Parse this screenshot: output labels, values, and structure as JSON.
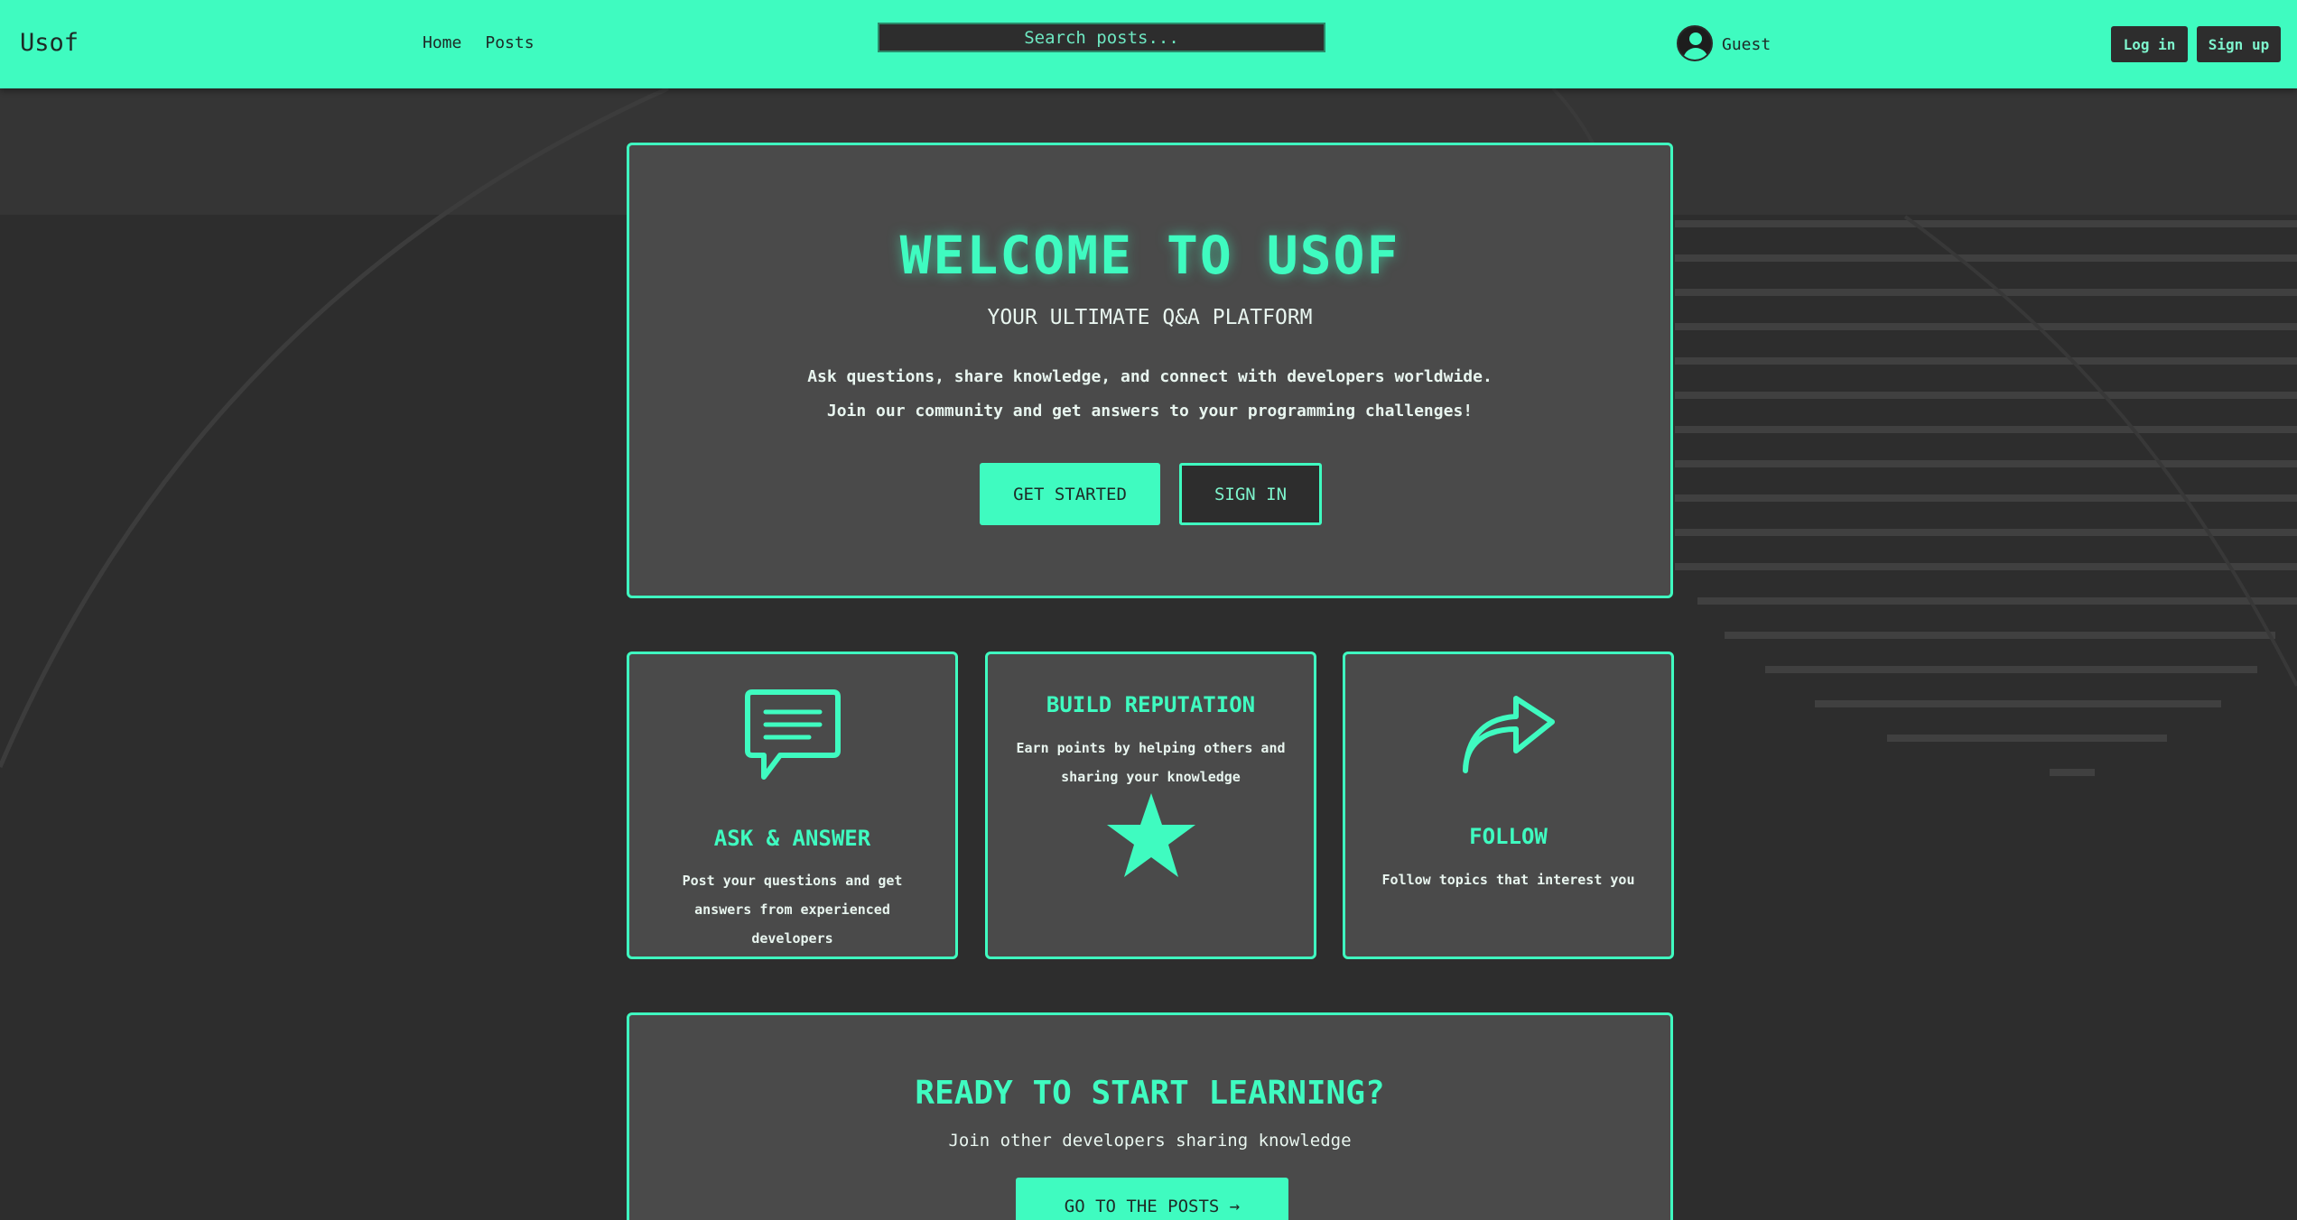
{
  "header": {
    "logo": "Usof",
    "nav": [
      "Home",
      "Posts"
    ],
    "search_placeholder": "Search posts...",
    "user_name": "Guest",
    "login_label": "Log in",
    "signup_label": "Sign up"
  },
  "hero": {
    "title": "WELCOME TO USOF",
    "subtitle": "YOUR ULTIMATE Q&A PLATFORM",
    "description": "Ask questions, share knowledge, and connect with developers worldwide. Join our community and get answers to your programming challenges!",
    "get_started_label": "GET STARTED",
    "sign_in_label": "SIGN IN"
  },
  "features": [
    {
      "icon": "chat-bubble-icon",
      "title": "ASK & ANSWER",
      "description": "Post your questions and get answers from experienced developers"
    },
    {
      "icon": "star-icon",
      "title": "BUILD REPUTATION",
      "description": "Earn points by helping others and sharing your knowledge"
    },
    {
      "icon": "share-arrow-icon",
      "title": "FOLLOW",
      "description": "Follow topics that interest you"
    }
  ],
  "cta": {
    "title": "READY TO START LEARNING?",
    "subtitle": "Join other developers sharing knowledge",
    "button_label": "GO TO THE POSTS →"
  },
  "colors": {
    "accent": "#3ffbc0",
    "background": "#2d2d2d",
    "card": "#4a4a4a"
  }
}
